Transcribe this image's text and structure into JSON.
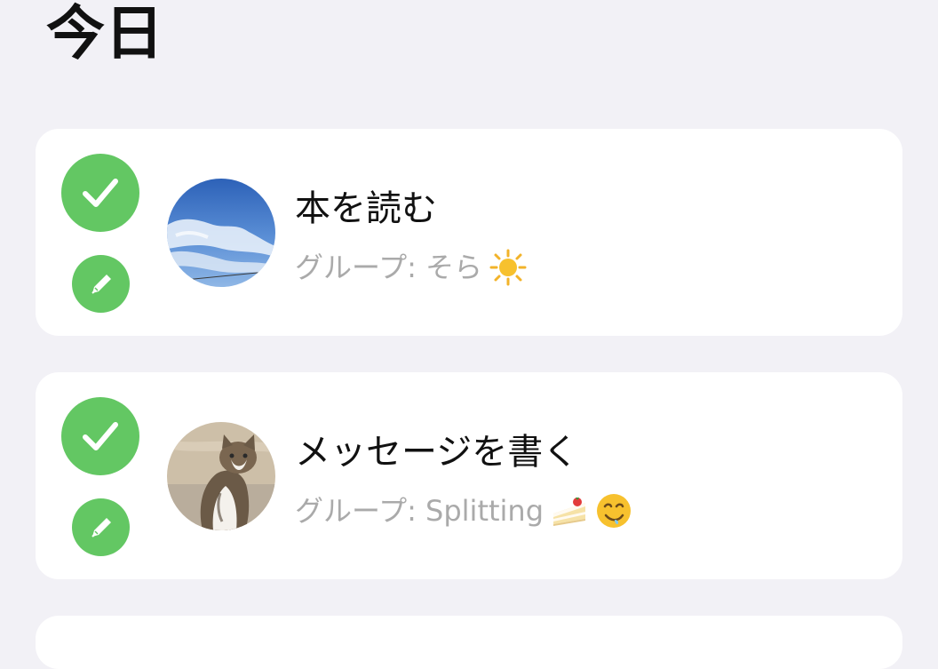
{
  "header": {
    "title": "今日"
  },
  "tasks": [
    {
      "title": "本を読む",
      "group_label": "グループ: そら",
      "group_icons": [
        "sun-icon"
      ],
      "avatar": "sky-photo",
      "completed": true
    },
    {
      "title": "メッセージを書く",
      "group_label": "グループ: Splitting",
      "group_icons": [
        "shortcake-icon",
        "drooling-face-icon"
      ],
      "avatar": "cat-photo",
      "completed": true
    }
  ],
  "colors": {
    "background": "#f2f1f6",
    "card": "#ffffff",
    "accent_green": "#63c763",
    "secondary_text": "#aaaaaa"
  }
}
